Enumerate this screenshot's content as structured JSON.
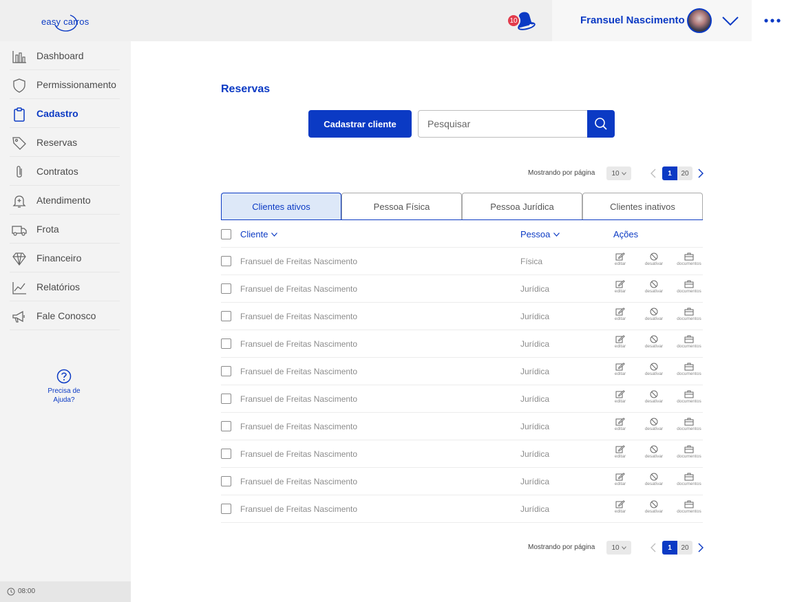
{
  "app": {
    "logo_text": "easy carros"
  },
  "header": {
    "notification_count": "10",
    "user_name": "Fransuel Nascimento"
  },
  "sidebar": {
    "items": [
      {
        "label": "Dashboard",
        "icon": "bar-chart-icon",
        "active": false
      },
      {
        "label": "Permissionamento",
        "icon": "shield-icon",
        "active": false
      },
      {
        "label": "Cadastro",
        "icon": "clipboard-icon",
        "active": true
      },
      {
        "label": "Reservas",
        "icon": "tag-icon",
        "active": false
      },
      {
        "label": "Contratos",
        "icon": "paperclip-icon",
        "active": false
      },
      {
        "label": "Atendimento",
        "icon": "bell-icon",
        "active": false
      },
      {
        "label": "Frota",
        "icon": "truck-icon",
        "active": false
      },
      {
        "label": "Financeiro",
        "icon": "diamond-icon",
        "active": false
      },
      {
        "label": "Relatórios",
        "icon": "line-chart-icon",
        "active": false
      },
      {
        "label": "Fale Conosco",
        "icon": "megaphone-icon",
        "active": false
      }
    ],
    "help_label": "Precisa de Ajuda?",
    "clock": "08:00"
  },
  "main": {
    "title": "Reservas",
    "add_button": "Cadastrar cliente",
    "search_placeholder": "Pesquisar",
    "pagination": {
      "label": "Mostrando por página",
      "per_page": "10",
      "pages": [
        "1",
        "20"
      ],
      "current": "1"
    },
    "tabs": [
      {
        "label": "Clientes ativos",
        "active": true
      },
      {
        "label": "Pessoa Física",
        "active": false
      },
      {
        "label": "Pessoa Jurídica",
        "active": false
      },
      {
        "label": "Clientes inativos",
        "active": false
      }
    ],
    "columns": {
      "cliente": "Cliente",
      "pessoa": "Pessoa",
      "acoes": "Ações"
    },
    "action_labels": {
      "edit": "editar",
      "deactivate": "desativar",
      "documents": "documentos"
    },
    "rows": [
      {
        "name": "Fransuel de Freitas Nascimento",
        "type": "Física"
      },
      {
        "name": "Fransuel de Freitas Nascimento",
        "type": "Jurídica"
      },
      {
        "name": "Fransuel de Freitas Nascimento",
        "type": "Jurídica"
      },
      {
        "name": "Fransuel de Freitas Nascimento",
        "type": "Jurídica"
      },
      {
        "name": "Fransuel de Freitas Nascimento",
        "type": "Jurídica"
      },
      {
        "name": "Fransuel de Freitas Nascimento",
        "type": "Jurídica"
      },
      {
        "name": "Fransuel de Freitas Nascimento",
        "type": "Jurídica"
      },
      {
        "name": "Fransuel de Freitas Nascimento",
        "type": "Jurídica"
      },
      {
        "name": "Fransuel de Freitas Nascimento",
        "type": "Jurídica"
      },
      {
        "name": "Fransuel de Freitas Nascimento",
        "type": "Jurídica"
      }
    ]
  },
  "colors": {
    "accent": "#0b3ac4",
    "sidebar_bg": "#f3f3f3",
    "header_bg": "#efefef",
    "badge": "#e23b4c",
    "tab_active_bg": "#dde8f8"
  }
}
